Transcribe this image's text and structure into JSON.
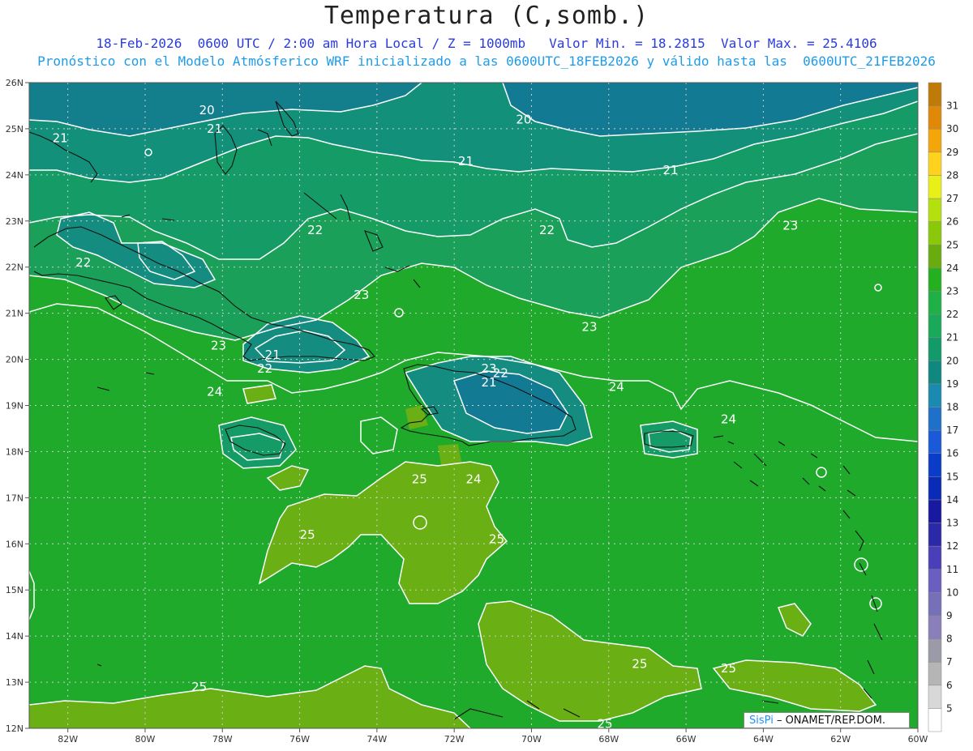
{
  "header": {
    "title": "Temperatura (C,somb.)",
    "subtitle1": "18-Feb-2026  0600 UTC / 2:00 am Hora Local / Z = 1000mb   Valor Min. = 18.2815  Valor Max. = 25.4106",
    "subtitle2": "Pronóstico con el Modelo Atmósferico WRF inicializado a las 0600UTC_18FEB2026 y válido hasta las  0600UTC_21FEB2026"
  },
  "map": {
    "lon_range": [
      -83,
      -60
    ],
    "lat_range": [
      12,
      26
    ],
    "lon_ticks": [
      "82W",
      "80W",
      "78W",
      "76W",
      "74W",
      "72W",
      "70W",
      "68W",
      "66W",
      "64W",
      "62W",
      "60W"
    ],
    "lat_ticks": [
      "12N",
      "13N",
      "14N",
      "15N",
      "16N",
      "17N",
      "18N",
      "19N",
      "20N",
      "21N",
      "22N",
      "23N",
      "24N",
      "25N",
      "26N"
    ],
    "contour_labels": [
      {
        "text": "20",
        "lon": -78.4,
        "lat": 25.4
      },
      {
        "text": "21",
        "lon": -78.2,
        "lat": 25.0
      },
      {
        "text": "21",
        "lon": -82.2,
        "lat": 24.8
      },
      {
        "text": "20",
        "lon": -70.2,
        "lat": 25.2
      },
      {
        "text": "21",
        "lon": -71.7,
        "lat": 24.3
      },
      {
        "text": "21",
        "lon": -66.4,
        "lat": 24.1
      },
      {
        "text": "22",
        "lon": -75.6,
        "lat": 22.8
      },
      {
        "text": "22",
        "lon": -69.6,
        "lat": 22.8
      },
      {
        "text": "23",
        "lon": -63.3,
        "lat": 22.9
      },
      {
        "text": "22",
        "lon": -81.6,
        "lat": 22.1
      },
      {
        "text": "23",
        "lon": -74.4,
        "lat": 21.4
      },
      {
        "text": "23",
        "lon": -68.5,
        "lat": 20.7
      },
      {
        "text": "23",
        "lon": -78.1,
        "lat": 20.3
      },
      {
        "text": "21",
        "lon": -76.7,
        "lat": 20.1
      },
      {
        "text": "22",
        "lon": -76.9,
        "lat": 19.8
      },
      {
        "text": "23",
        "lon": -71.1,
        "lat": 19.8
      },
      {
        "text": "22",
        "lon": -70.8,
        "lat": 19.7
      },
      {
        "text": "21",
        "lon": -71.1,
        "lat": 19.5
      },
      {
        "text": "24",
        "lon": -67.8,
        "lat": 19.4
      },
      {
        "text": "24",
        "lon": -78.2,
        "lat": 19.3
      },
      {
        "text": "24",
        "lon": -64.9,
        "lat": 18.7
      },
      {
        "text": "25",
        "lon": -72.9,
        "lat": 17.4
      },
      {
        "text": "24",
        "lon": -71.5,
        "lat": 17.4
      },
      {
        "text": "25",
        "lon": -75.8,
        "lat": 16.2
      },
      {
        "text": "25",
        "lon": -70.9,
        "lat": 16.1
      },
      {
        "text": "25",
        "lon": -67.2,
        "lat": 13.4
      },
      {
        "text": "25",
        "lon": -64.9,
        "lat": 13.3
      },
      {
        "text": "25",
        "lon": -78.6,
        "lat": 12.9
      },
      {
        "text": "25",
        "lon": -68.1,
        "lat": 12.1
      }
    ]
  },
  "colorbar": {
    "labels": [
      "5",
      "6",
      "7",
      "8",
      "9",
      "10",
      "11",
      "12",
      "13",
      "14",
      "15",
      "16",
      "17",
      "18",
      "19",
      "20",
      "21",
      "22",
      "23",
      "24",
      "25",
      "26",
      "27",
      "28",
      "29",
      "30",
      "31"
    ],
    "colors": [
      "#ffffff",
      "#d8d8d8",
      "#b5b5b5",
      "#9a9aa8",
      "#8a7fb8",
      "#7570b8",
      "#6a5fc0",
      "#4a3fb8",
      "#2a2aa8",
      "#1818a0",
      "#0a2ab8",
      "#0a3cc8",
      "#1a5ad8",
      "#1e70c8",
      "#1a8ab0",
      "#108880",
      "#129a6a",
      "#1aa85a",
      "#20b048",
      "#24b020",
      "#6aac10",
      "#8cc80a",
      "#b4e010",
      "#e8f018",
      "#ffd21e",
      "#f4a50a",
      "#e08808",
      "#c07a08"
    ]
  },
  "colors": {
    "deep": "#137a93",
    "teal": "#158c80",
    "green": "#1aa058",
    "field": "#1faa2c",
    "olive": "#6aaf14",
    "contour": "#ffffff",
    "coast": "#101010",
    "grid": "#cfcfcf"
  },
  "credit": {
    "sis": "SisPi",
    "rest": " – ONAMET/REP.DOM."
  }
}
